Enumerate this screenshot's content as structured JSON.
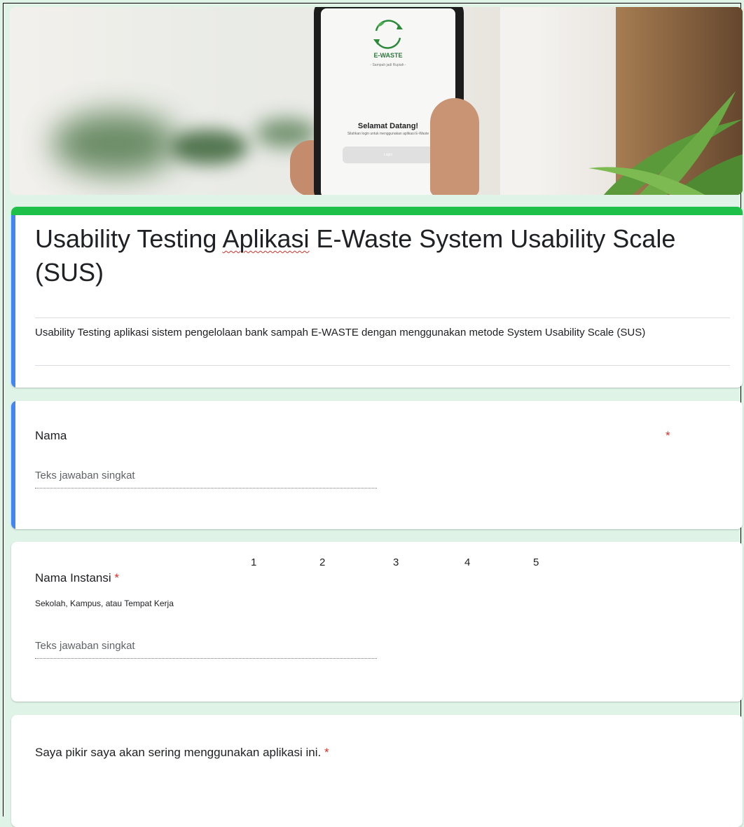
{
  "header_banner": {
    "phone_screen": {
      "logo_text": "E-WASTE",
      "tagline": "- Sampah jadi Rupiah -",
      "welcome": "Selamat Datang!",
      "subtitle": "Silahkan login untuk menggunakan aplikasi E-Waste",
      "button": "Login"
    }
  },
  "form": {
    "title_part1": "Usability Testing ",
    "title_misspelled": "Aplikasi",
    "title_part2": " E-Waste System Usability Scale (SUS)",
    "description": "Usability Testing aplikasi sistem pengelolaan bank sampah E-WASTE dengan menggunakan metode System Usability Scale (SUS)"
  },
  "questions": [
    {
      "label": "Nama",
      "required_mark": "*",
      "placeholder": "Teks jawaban singkat"
    },
    {
      "label": "Nama Instansi ",
      "required_mark": "*",
      "help": "Sekolah, Kampus, atau Tempat Kerja",
      "placeholder": "Teks jawaban singkat"
    },
    {
      "label": "Saya pikir saya akan sering menggunakan aplikasi ini. ",
      "required_mark": "*",
      "scale": [
        "1",
        "2",
        "3",
        "4",
        "5"
      ]
    }
  ],
  "colors": {
    "background": "#dff3e6",
    "accent_green": "#1dc14a",
    "focus_blue": "#4285f4",
    "required_red": "#d93025"
  }
}
